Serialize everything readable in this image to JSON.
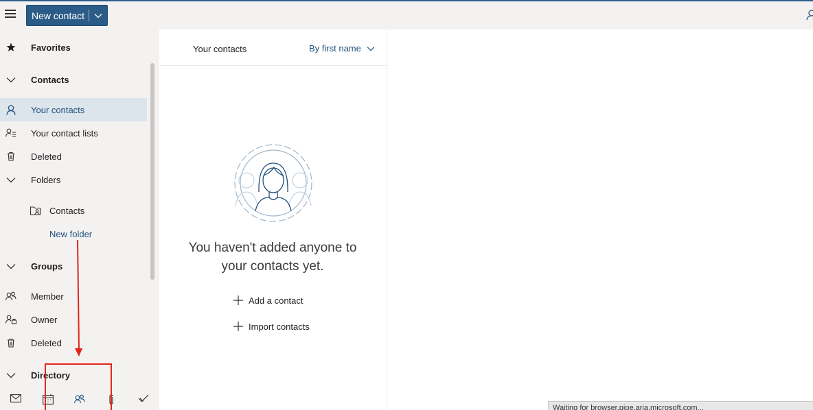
{
  "header": {
    "new_contact_label": "New contact"
  },
  "sidebar": {
    "items": [
      {
        "label": "Favorites"
      },
      {
        "label": "Contacts"
      },
      {
        "label": "Your contacts"
      },
      {
        "label": "Your contact lists"
      },
      {
        "label": "Deleted"
      },
      {
        "label": "Folders"
      },
      {
        "label": "Contacts"
      },
      {
        "label": "New folder"
      },
      {
        "label": "Groups"
      },
      {
        "label": "Member"
      },
      {
        "label": "Owner"
      },
      {
        "label": "Deleted"
      },
      {
        "label": "Directory"
      }
    ]
  },
  "list": {
    "title": "Your contacts",
    "sort_label": "By first name",
    "empty_message": "You haven't added anyone to your contacts yet.",
    "add_contact": "Add a contact",
    "import_contacts": "Import contacts"
  },
  "status_bar": {
    "text": "Waiting for browser.pipe.aria.microsoft.com..."
  },
  "colors": {
    "accent": "#2b5c88",
    "selected_bg": "#dce4ec",
    "annotation": "#e0261b"
  }
}
